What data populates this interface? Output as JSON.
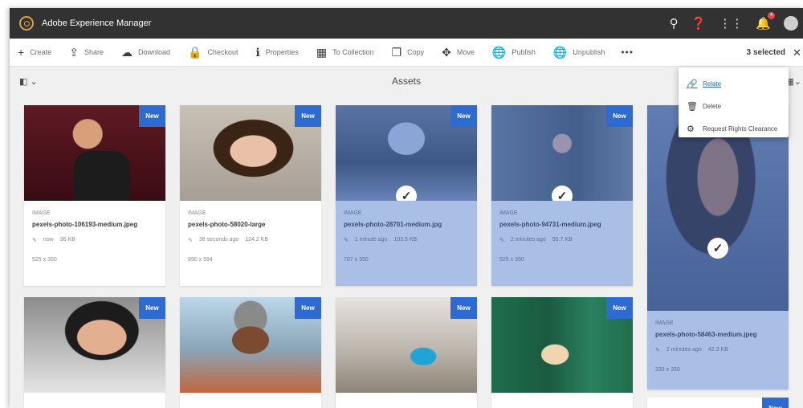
{
  "header": {
    "app_title": "Adobe Experience Manager",
    "notification_count": "4"
  },
  "toolbar": {
    "create": "Create",
    "share": "Share",
    "download": "Download",
    "checkout": "Checkout",
    "properties": "Properties",
    "to_collection": "To Collection",
    "copy": "Copy",
    "move": "Move",
    "publish": "Publish",
    "unpublish": "Unpublish",
    "more": "•••",
    "selected": "3 selected",
    "close": "✕"
  },
  "page": {
    "title": "Assets"
  },
  "menu": {
    "items": [
      {
        "label": "Relate",
        "icon": "link-icon"
      },
      {
        "label": "Delete",
        "icon": "trash-icon"
      },
      {
        "label": "Request Rights Clearance",
        "icon": "rights-icon"
      }
    ]
  },
  "badge_label": "New",
  "cards": [
    {
      "type": "IMAGE",
      "name": "pexels-photo-106193-medium.jpeg",
      "time": "now",
      "size": "36 KB",
      "dims": "525 x 350",
      "selected": false
    },
    {
      "type": "IMAGE",
      "name": "pexels-photo-58020-large",
      "time": "38 seconds ago",
      "size": "124.2 KB",
      "dims": "890 x 594",
      "selected": false
    },
    {
      "type": "IMAGE",
      "name": "pexels-photo-28701-medium.jpg",
      "time": "1 minute ago",
      "size": "103.5 KB",
      "dims": "787 x 350",
      "selected": true
    },
    {
      "type": "IMAGE",
      "name": "pexels-photo-94731-medium.jpeg",
      "time": "2 minutes ago",
      "size": "55.7 KB",
      "dims": "525 x 350",
      "selected": true
    },
    {
      "type": "IMAGE",
      "name": "pexels-photo-58463-medium.jpeg",
      "time": "2 minutes ago",
      "size": "42.3 KB",
      "dims": "233 x 350",
      "selected": true
    }
  ],
  "colors": {
    "header_bg": "#323232",
    "accent_blue": "#2d6bd0",
    "selection_tint": "#a9bfe6"
  }
}
